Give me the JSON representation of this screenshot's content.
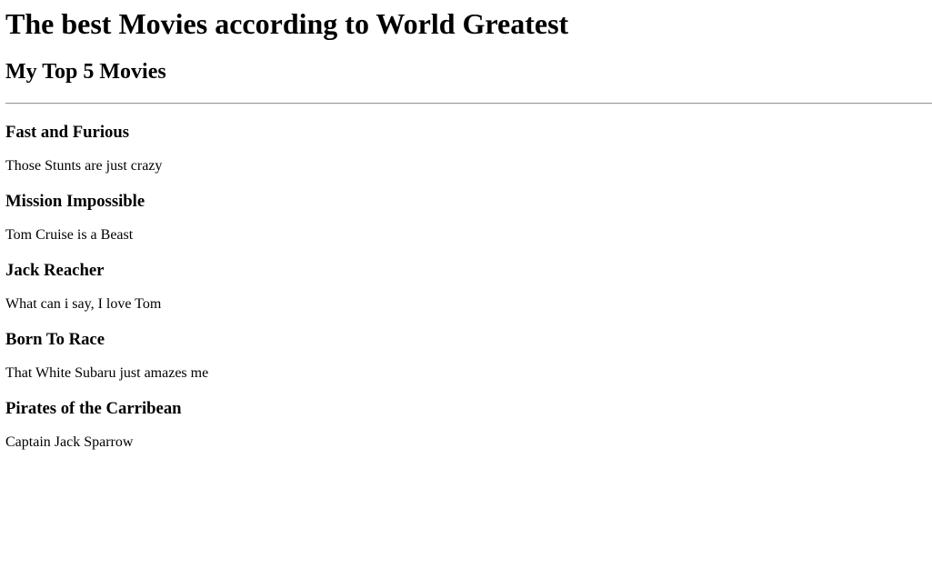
{
  "page": {
    "title": "The best Movies according to World Greatest",
    "subtitle": "My Top 5 Movies"
  },
  "movies": [
    {
      "title": "Fast and Furious",
      "comment": "Those Stunts are just crazy"
    },
    {
      "title": "Mission Impossible",
      "comment": "Tom Cruise is a Beast"
    },
    {
      "title": "Jack Reacher",
      "comment": "What can i say, I love Tom"
    },
    {
      "title": "Born To Race",
      "comment": "That White Subaru just amazes me"
    },
    {
      "title": "Pirates of the Carribean",
      "comment": "Captain Jack Sparrow"
    }
  ]
}
